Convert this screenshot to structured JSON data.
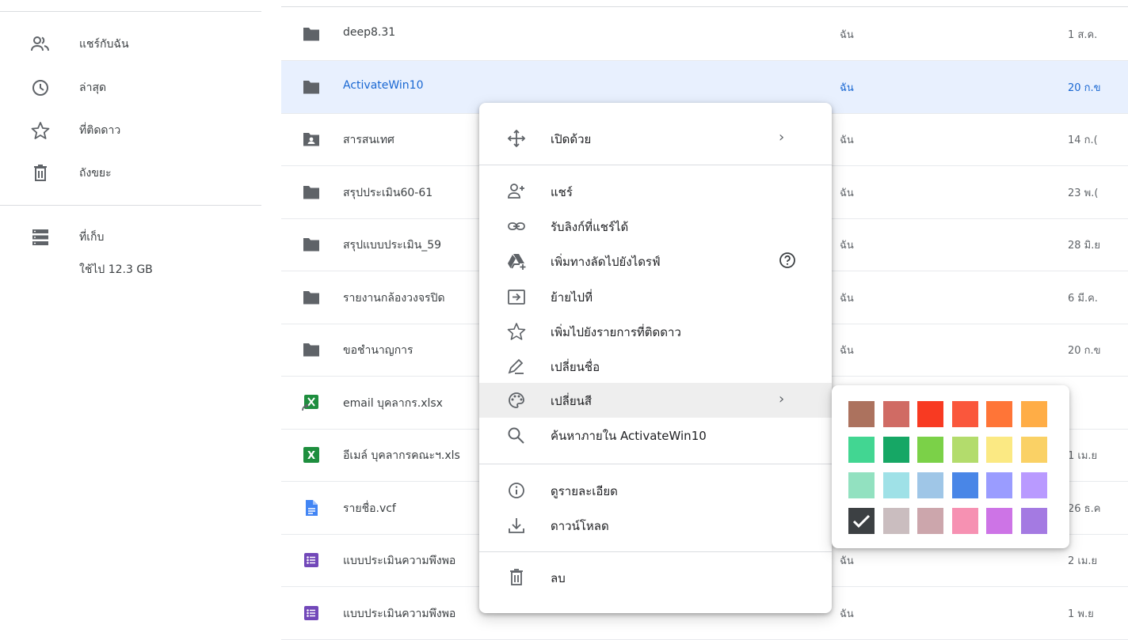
{
  "sidebar": {
    "items": [
      {
        "label": "แชร์กับฉัน",
        "icon": "shared-with-me-icon"
      },
      {
        "label": "ล่าสุด",
        "icon": "recent-clock-icon"
      },
      {
        "label": "ที่ติดดาว",
        "icon": "star-icon"
      },
      {
        "label": "ถังขยะ",
        "icon": "trash-icon"
      }
    ],
    "storage": {
      "label": "ที่เก็บ",
      "usage": "ใช้ไป 12.3 GB",
      "icon": "storage-icon"
    }
  },
  "files": [
    {
      "name": "deep8.31",
      "owner": "ฉัน",
      "date": "1 ส.ค.",
      "type": "folder"
    },
    {
      "name": "ActivateWin10",
      "owner": "ฉัน",
      "date": "20 ก.ข",
      "type": "folder",
      "selected": true
    },
    {
      "name": "สารสนเทศ",
      "owner": "ฉัน",
      "date": "14 ก.(",
      "type": "shared-folder"
    },
    {
      "name": "สรุปประเมิน60-61",
      "owner": "ฉัน",
      "date": "23 พ.(",
      "type": "folder"
    },
    {
      "name": "สรุปแบบประเมิน_59",
      "owner": "ฉัน",
      "date": "28 มิ.ย",
      "type": "folder"
    },
    {
      "name": "รายงานกล้องวงจรปิด",
      "owner": "ฉัน",
      "date": "6 มี.ค.",
      "type": "folder"
    },
    {
      "name": "ขอชำนาญการ",
      "owner": "ฉัน",
      "date": "20 ก.ข",
      "type": "folder"
    },
    {
      "name": "email บุคลากร.xlsx",
      "owner": "",
      "date": "",
      "type": "excel-shortcut"
    },
    {
      "name": "อีเมล์ บุคลากรคณะฯ.xls",
      "owner": "",
      "date": "1 เม.ย",
      "type": "excel"
    },
    {
      "name": "รายชื่อ.vcf",
      "owner": "",
      "date": "26 ธ.ค",
      "type": "doc"
    },
    {
      "name": "แบบประเมินความพึงพอ",
      "owner": "ฉัน",
      "date": "2 เม.ย",
      "type": "form"
    },
    {
      "name": "แบบประเมินความพึงพอ",
      "owner": "ฉัน",
      "date": "1 พ.ย",
      "type": "form"
    }
  ],
  "context_menu": {
    "items": [
      {
        "label": "เปิดด้วย",
        "icon": "open-with-icon",
        "submenu": true
      },
      {
        "label": "แชร์",
        "icon": "share-person-add-icon"
      },
      {
        "label": "รับลิงก์ที่แชร์ได้",
        "icon": "link-icon"
      },
      {
        "label": "เพิ่มทางลัดไปยังไดรฟ์",
        "icon": "add-to-drive-icon",
        "help": true
      },
      {
        "label": "ย้ายไปที่",
        "icon": "move-to-icon"
      },
      {
        "label": "เพิ่มไปยังรายการที่ติดดาว",
        "icon": "star-outline-icon"
      },
      {
        "label": "เปลี่ยนชื่อ",
        "icon": "rename-pencil-icon"
      },
      {
        "label": "เปลี่ยนสี",
        "icon": "palette-icon",
        "submenu": true,
        "hover": true
      },
      {
        "label": "ค้นหาภายใน ActivateWin10",
        "icon": "search-icon"
      },
      {
        "label": "ดูรายละเอียด",
        "icon": "info-icon"
      },
      {
        "label": "ดาวน์โหลด",
        "icon": "download-icon"
      },
      {
        "label": "ลบ",
        "icon": "trash-icon"
      }
    ],
    "chevron": "›"
  },
  "palette": {
    "colors": [
      "#ac725e",
      "#d06b64",
      "#f83a22",
      "#fa573c",
      "#ff7537",
      "#ffad46",
      "#42d692",
      "#16a765",
      "#7bd148",
      "#b3dc6c",
      "#fbe983",
      "#fad165",
      "#92e1c0",
      "#9fe1e7",
      "#9fc6e7",
      "#4986e7",
      "#9a9cff",
      "#b99aff",
      "#8f8f8f",
      "#cabdbf",
      "#cca6ac",
      "#f691b2",
      "#cd74e6",
      "#a47ae2"
    ],
    "selected_index": 18
  }
}
